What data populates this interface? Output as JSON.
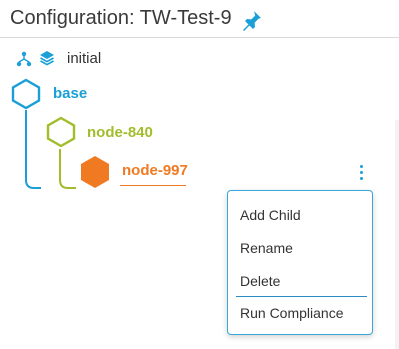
{
  "header": {
    "title": "Configuration: TW-Test-9",
    "pin_icon": "pin-icon",
    "pin_color": "#1a9fd6"
  },
  "toolbar": {
    "icons": [
      "hierarchy-icon",
      "layers-icon"
    ],
    "label": "initial"
  },
  "tree": {
    "nodes": [
      {
        "label": "base",
        "color": "#1a9fd6",
        "icon": "hexagon-outline-icon"
      },
      {
        "label": "node-840",
        "color": "#a2bd2c",
        "icon": "hexagon-outline-icon"
      },
      {
        "label": "node-997",
        "color": "#f07a22",
        "icon": "hexagon-filled-icon",
        "selected": true
      }
    ]
  },
  "context_menu": {
    "trigger_icon": "kebab-menu-icon",
    "items": [
      {
        "label": "Add Child"
      },
      {
        "label": "Rename"
      },
      {
        "label": "Delete"
      },
      {
        "label": "Run Compliance"
      }
    ]
  }
}
